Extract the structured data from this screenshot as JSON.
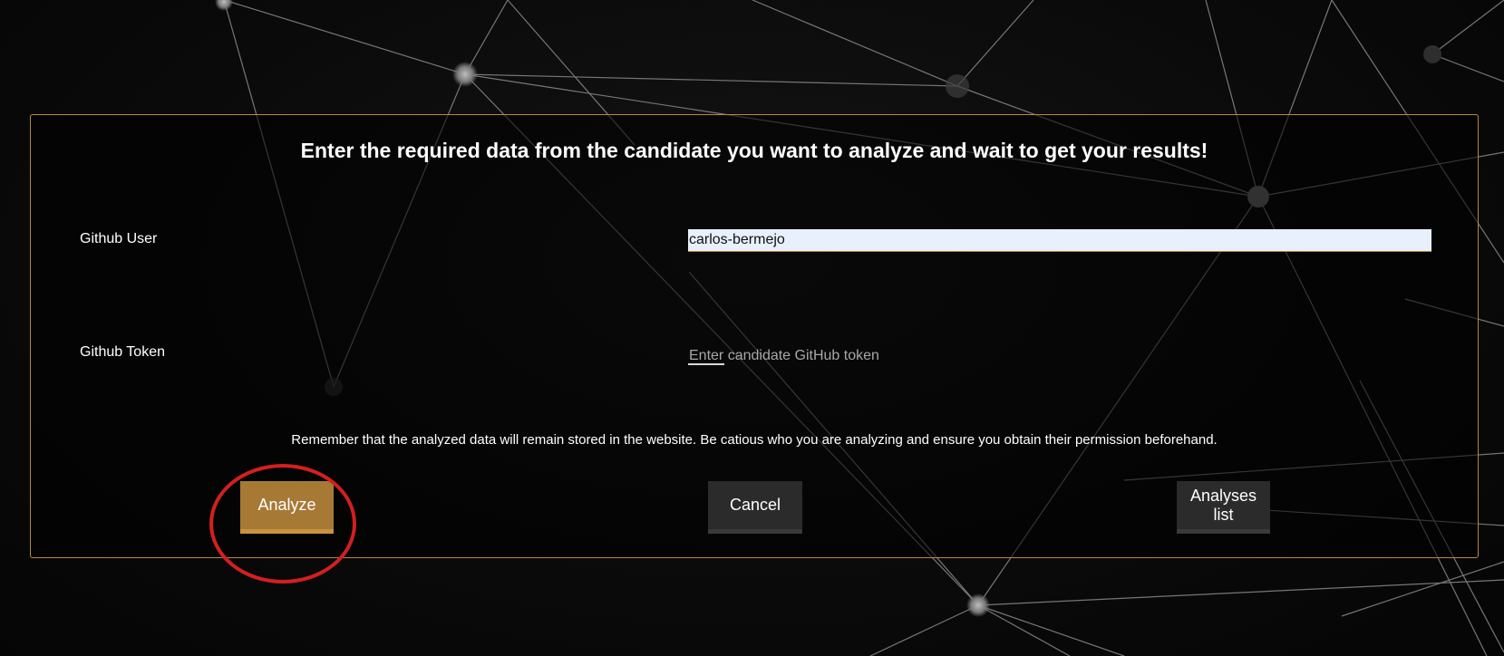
{
  "form": {
    "title": "Enter the required data from the candidate you want to analyze and wait to get your results!",
    "github_user": {
      "label": "Github User",
      "value": "carlos-bermejo"
    },
    "github_token": {
      "label": "Github Token",
      "value": "",
      "placeholder": "Enter candidate GitHub token"
    },
    "notice": "Remember that the analyzed data will remain stored in the website. Be catious who you are analyzing and ensure you obtain their permission beforehand.",
    "buttons": {
      "analyze": "Analyze",
      "cancel": "Cancel",
      "analyses_list": "Analyses list"
    }
  },
  "colors": {
    "accent": "#b48a3c",
    "analyze_button": "#a67a35",
    "secondary_button": "#2b2b2b",
    "highlight_ring": "#d41f1f",
    "background": "#0b0b0b"
  }
}
